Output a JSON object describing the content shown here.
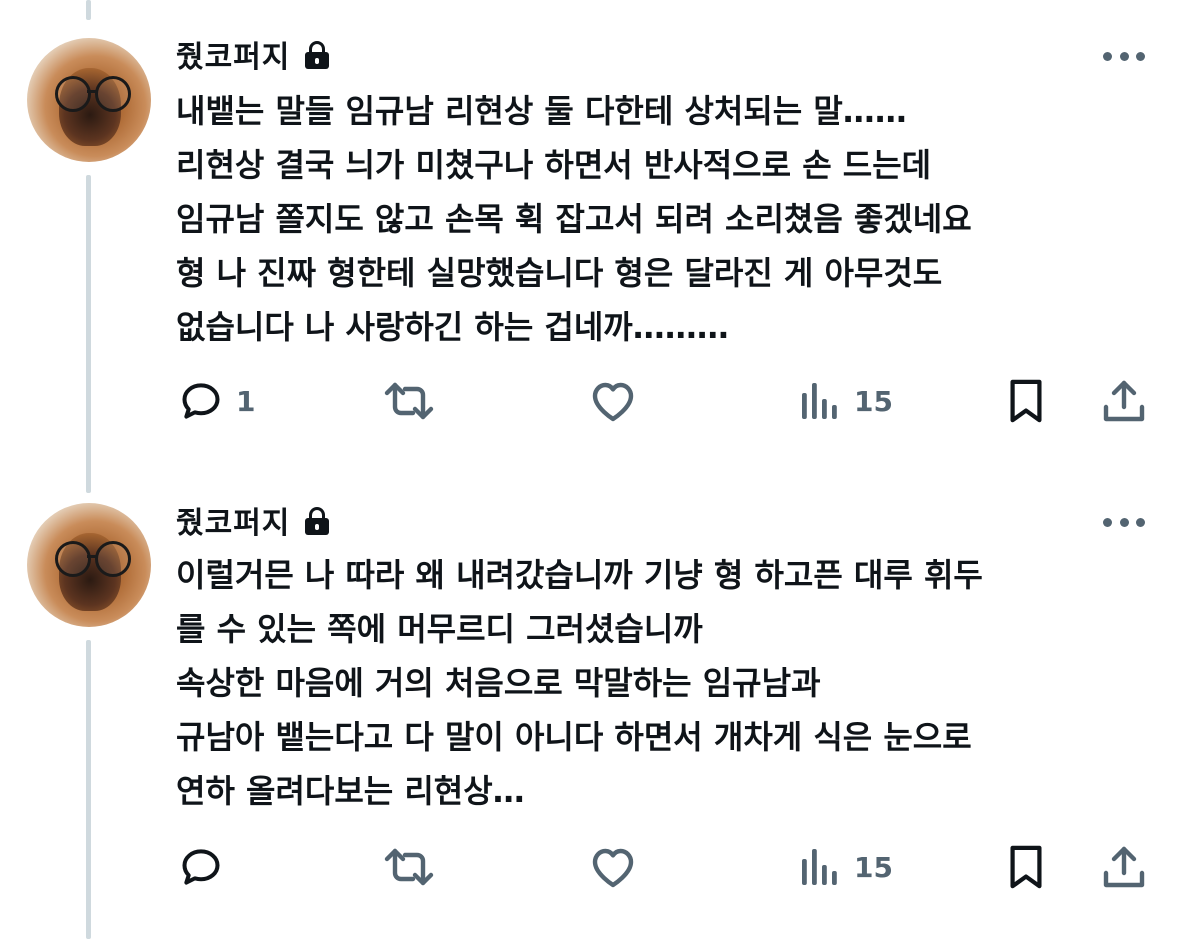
{
  "tweets": [
    {
      "author": "줬코퍼지",
      "lines": [
        "내뱉는 말들 임규남 리현상 둘 다한테 상처되는 말……",
        "리현상 결국 늬가 미쳤구나 하면서 반사적으로 손 드는데",
        "임규남 쫄지도 않고 손목 휙 잡고서 되려 소리쳤음 좋겠네요",
        "형  나 진짜 형한테 실망했습니다 형은 달라진 게 아무것도",
        "없습니다 나 사랑하긴 하는 겁네까………"
      ],
      "reply_count": "1",
      "views_count": "15"
    },
    {
      "author": "줬코퍼지",
      "lines": [
        "이럴거믄 나 따라 왜 내려갔습니까 기냥 형 하고픈 대루 휘두",
        "를 수 있는 쪽에 머무르디 그러셨습니까",
        "속상한 마음에 거의 처음으로 막말하는 임규남과",
        "규남아 뱉는다고 다 말이 아니다 하면서 개차게 식은 눈으로",
        "연하 올려다보는 리현상…"
      ],
      "reply_count": "",
      "views_count": "15"
    }
  ],
  "icons": {
    "reply": "reply-icon",
    "retweet": "retweet-icon",
    "like": "heart-icon",
    "views": "views-icon",
    "bookmark": "bookmark-icon",
    "share": "share-icon",
    "more": "more-icon",
    "lock": "lock-icon"
  },
  "colors": {
    "text": "#0f1419",
    "secondary": "#536471",
    "thread_line": "#cfd9de",
    "background": "#ffffff"
  }
}
